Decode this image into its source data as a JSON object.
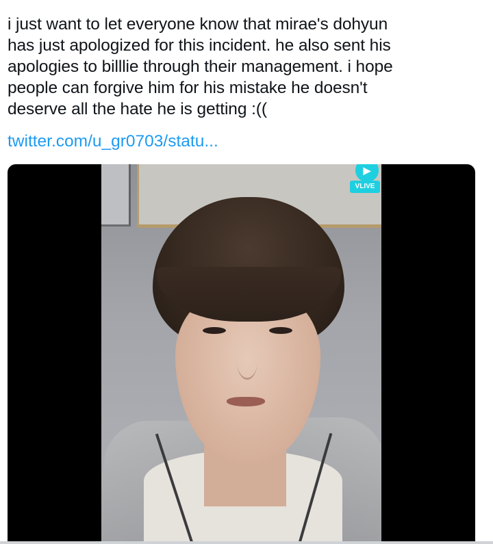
{
  "tweet": {
    "text_lines": [
      "i just want to let everyone know that mirae's dohyun",
      "has just apologized for this incident. he also sent his",
      "apologies to billlie through their management. i hope",
      "people can forgive him for his mistake he doesn't",
      "deserve all the hate he is getting :(("
    ],
    "link": "twitter.com/u_gr0703/statu..."
  },
  "media": {
    "watermark_icon": "vlive-logo-icon",
    "watermark_label": "VLIVE"
  },
  "colors": {
    "text": "#0f1419",
    "link": "#1d9bf0",
    "vlive": "#1ecfe0",
    "media_bg": "#000000"
  }
}
